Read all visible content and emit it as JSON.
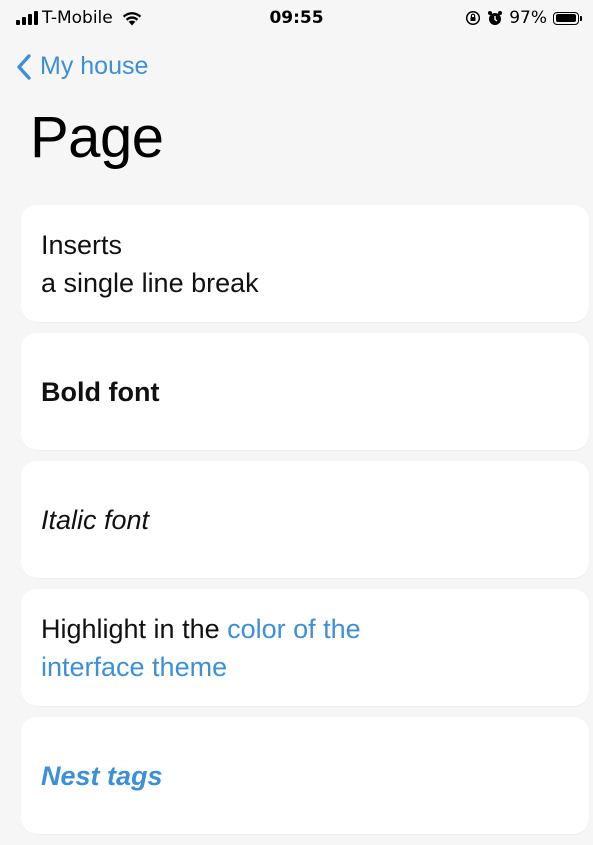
{
  "status_bar": {
    "carrier": "T-Mobile",
    "time": "09:55",
    "battery": "97%",
    "battery_level": 0.97,
    "icons": [
      "signal-icon",
      "wifi-icon",
      "orientation-lock-icon",
      "alarm-icon",
      "battery-icon"
    ]
  },
  "nav": {
    "back_label": "My house",
    "title": "Page"
  },
  "colors": {
    "accent": "#3d8fd6",
    "background": "#f6f6f6",
    "card": "#ffffff"
  },
  "cards": {
    "line_break": {
      "line1": "Inserts",
      "line2": "a single line break"
    },
    "bold": {
      "text": "Bold font"
    },
    "italic": {
      "text": "Italic font"
    },
    "highlight": {
      "plain": "Highlight in the ",
      "colored_line1": "color of the",
      "colored_line2": "interface theme"
    },
    "nest": {
      "text": "Nest tags"
    }
  }
}
